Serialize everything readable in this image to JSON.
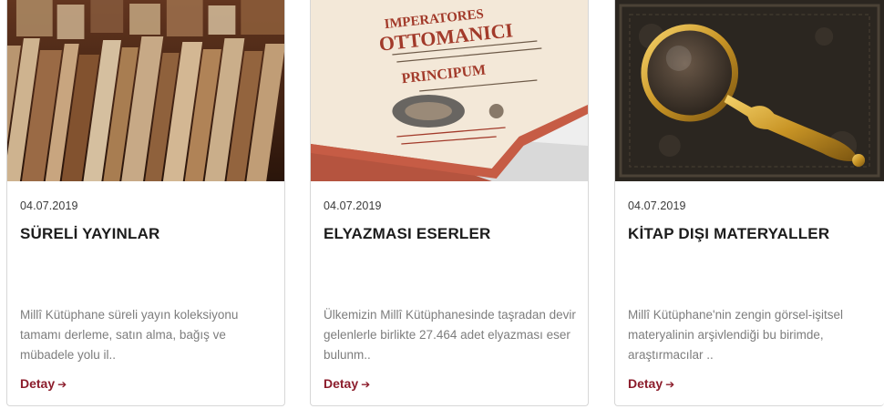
{
  "cards": [
    {
      "date": "04.07.2019",
      "title": "SÜRELİ YAYINLAR",
      "description": "Millî Kütüphane süreli yayın koleksiyonu tamamı derleme, satın alma, bağış ve mübadele yolu il..",
      "link_label": "Detay",
      "link_icon": "arrow-right-icon",
      "image": "books-on-shelf-photo"
    },
    {
      "date": "04.07.2019",
      "title": "ELYAZMASI ESERLER",
      "description": "Ülkemizin Millî Kütüphanesinde taşradan devir gelenlerle birlikte 27.464 adet elyazması eser bulunm..",
      "link_label": "Detay",
      "link_icon": "arrow-right-icon",
      "image": "old-manuscript-book-photo"
    },
    {
      "date": "04.07.2019",
      "title": "KİTAP DIŞI MATERYALLER",
      "description": "Millî Kütüphane'nin zengin görsel-işitsel materyalinin arşivlendiği bu birimde, araştırmacılar ..",
      "link_label": "Detay",
      "link_icon": "arrow-right-icon",
      "image": "magnifying-glass-photo"
    }
  ],
  "colors": {
    "accent": "#8c1d2c",
    "text": "#1c1c1c",
    "muted": "#7d7d7d"
  }
}
